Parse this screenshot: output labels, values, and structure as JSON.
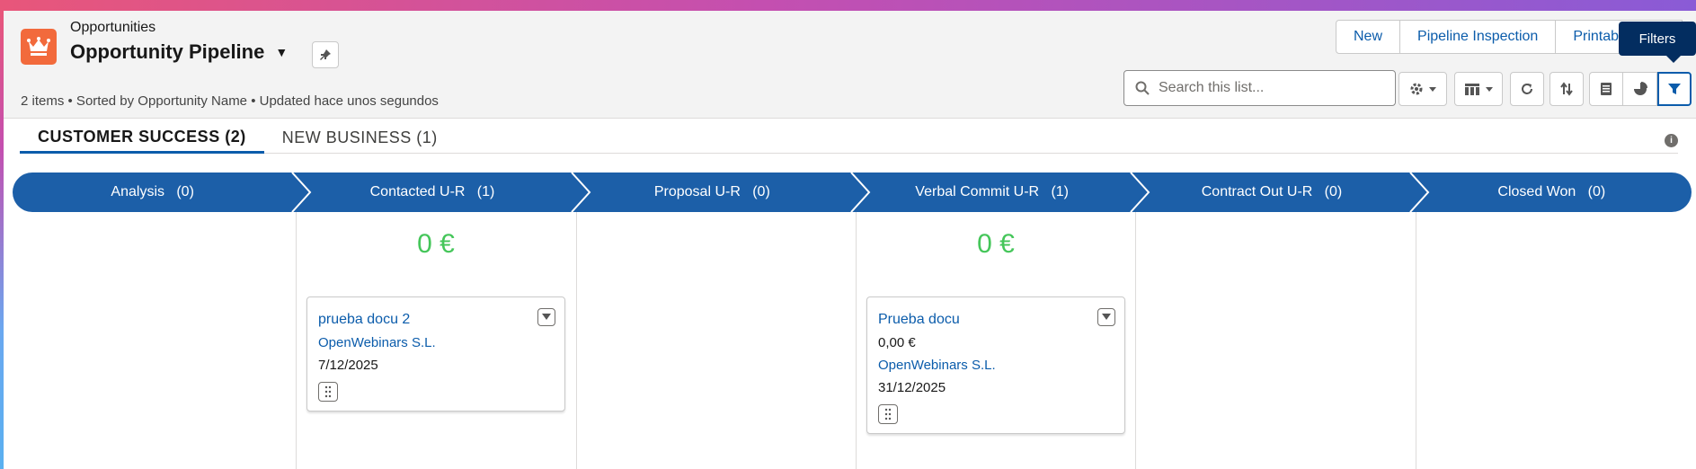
{
  "header": {
    "object_label": "Opportunities",
    "list_title": "Opportunity Pipeline",
    "summary": "2 items • Sorted by Opportunity Name • Updated hace unos segundos"
  },
  "actions": {
    "new_label": "New",
    "pipeline_inspection_label": "Pipeline Inspection",
    "printable_label": "Printable View"
  },
  "tooltip": {
    "text": "Filters"
  },
  "search": {
    "placeholder": "Search this list...",
    "value": ""
  },
  "tabs": [
    {
      "label": "CUSTOMER SUCCESS (2)",
      "active": true
    },
    {
      "label": "NEW BUSINESS (1)",
      "active": false
    }
  ],
  "stages": [
    {
      "label": "Analysis   (0)"
    },
    {
      "label": "Contacted U-R   (1)"
    },
    {
      "label": "Proposal U-R   (0)"
    },
    {
      "label": "Verbal Commit U-R   (1)"
    },
    {
      "label": "Contract Out U-R   (0)"
    },
    {
      "label": "Closed Won   (0)"
    }
  ],
  "columns": {
    "contacted": {
      "amount": "0 €",
      "card": {
        "title": "prueba docu 2",
        "account": "OpenWebinars S.L.",
        "date": "7/12/2025"
      }
    },
    "verbal_commit": {
      "amount": "0 €",
      "card": {
        "title": "Prueba docu",
        "amount": "0,00 €",
        "account": "OpenWebinars S.L.",
        "date": "31/12/2025"
      }
    }
  },
  "colors": {
    "stage_bar": "#1c5fa8",
    "amount": "#45c65a",
    "link": "#0b5cab",
    "app_icon": "#f26a3c"
  },
  "icons": [
    "crown-icon",
    "pin-icon",
    "search-icon",
    "gear-icon",
    "table-icon",
    "refresh-icon",
    "sort-icon",
    "list-icon",
    "chart-icon",
    "filter-icon",
    "info-icon",
    "chevron-down-icon",
    "drag-icon"
  ]
}
